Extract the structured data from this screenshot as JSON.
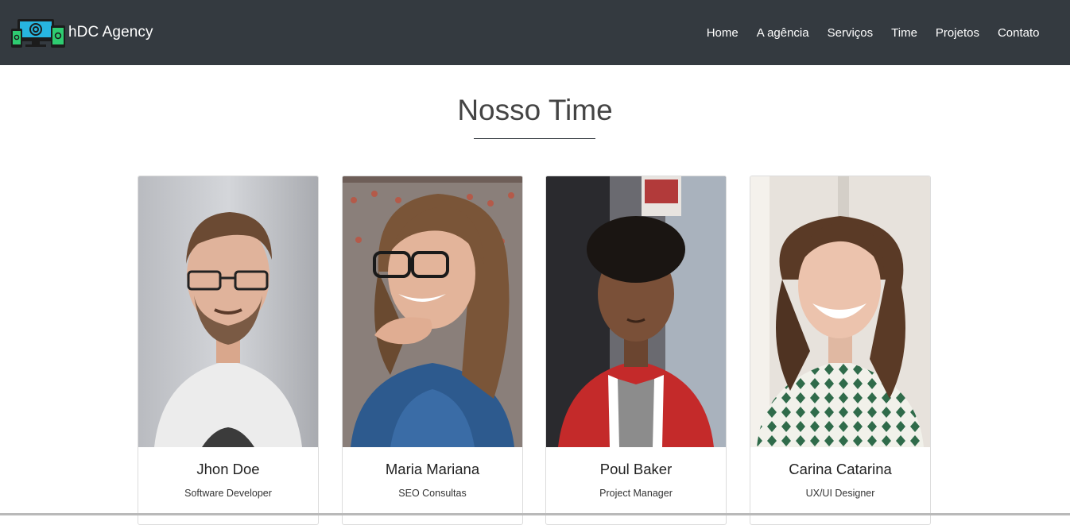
{
  "brand": {
    "name": "hDC Agency",
    "logo_icon": "devices-logo-icon"
  },
  "nav": {
    "items": [
      {
        "label": "Home"
      },
      {
        "label": "A agência"
      },
      {
        "label": "Serviços"
      },
      {
        "label": "Time"
      },
      {
        "label": "Projetos"
      },
      {
        "label": "Contato"
      }
    ]
  },
  "team": {
    "title": "Nosso Time",
    "members": [
      {
        "name": "Jhon Doe",
        "role": "Software Developer"
      },
      {
        "name": "Maria Mariana",
        "role": "SEO Consultas"
      },
      {
        "name": "Poul Baker",
        "role": "Project Manager"
      },
      {
        "name": "Carina Catarina",
        "role": "UX/UI Designer"
      }
    ]
  },
  "colors": {
    "navbar": "#343a40",
    "logo_screen": "#27b5e0",
    "logo_accent": "#2ecc71"
  }
}
